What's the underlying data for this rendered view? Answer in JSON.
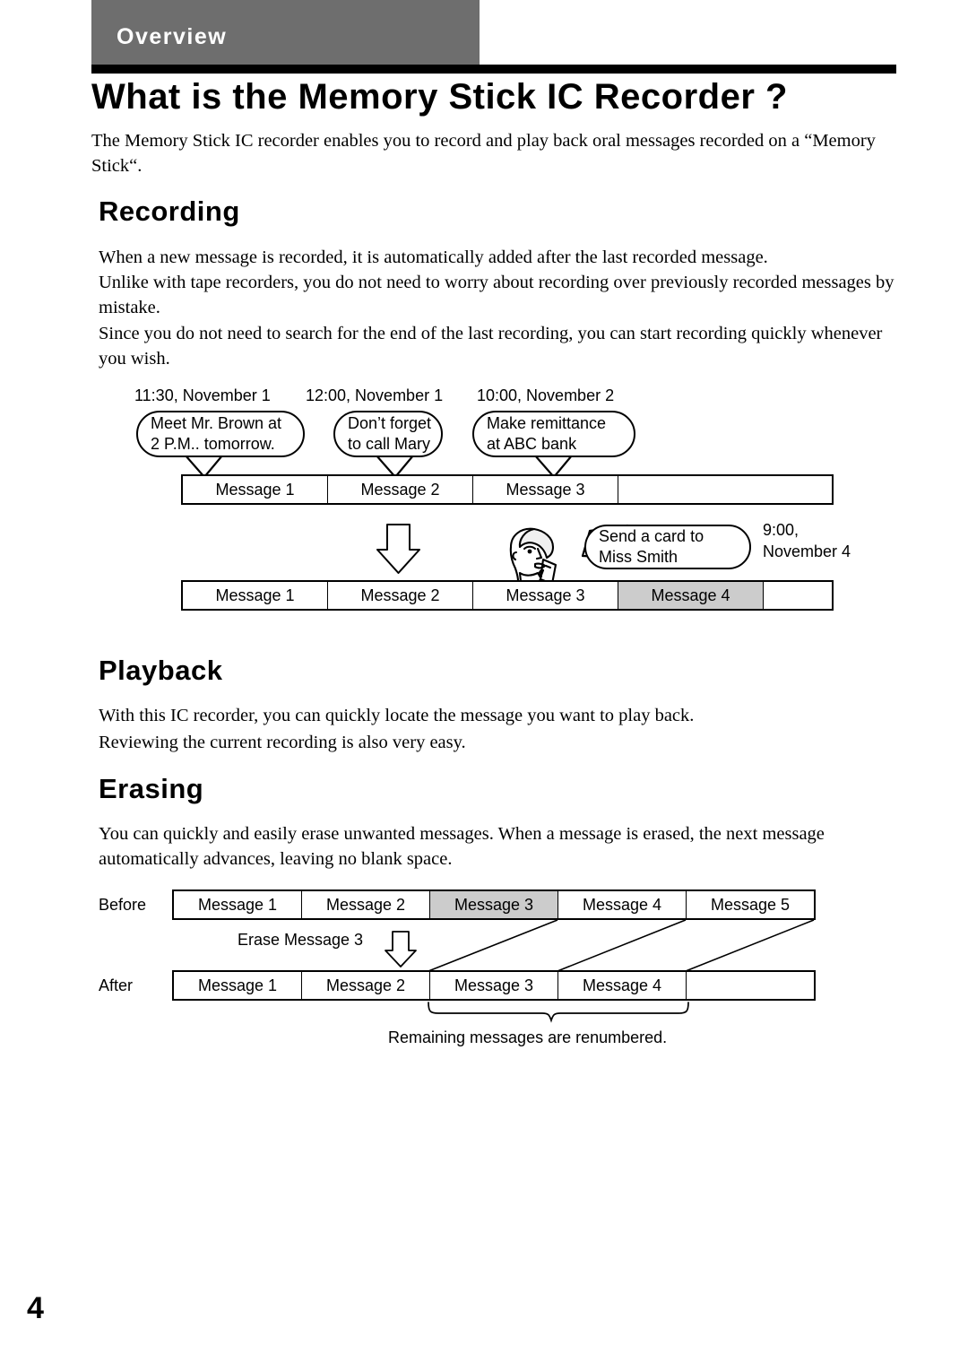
{
  "header": {
    "tab_label": "Overview",
    "title": "What is the Memory Stick IC Recorder ?"
  },
  "intro": "The Memory Stick IC recorder enables you to record and play back oral messages recorded on a “Memory Stick“.",
  "sections": {
    "recording": {
      "heading": "Recording",
      "paragraphs": [
        "When a new message is recorded, it is automatically added after the last recorded message.",
        "Unlike with tape recorders, you do not need to worry about recording over previously recorded messages by mistake.",
        "Since you do not need to search for the end of the last recording, you can start recording quickly whenever you wish."
      ]
    },
    "playback": {
      "heading": "Playback",
      "paragraphs": [
        "With this IC recorder, you can quickly locate the message you want to play back.",
        "Reviewing the current recording is also very easy."
      ]
    },
    "erasing": {
      "heading": "Erasing",
      "paragraphs": [
        "You can quickly and easily erase unwanted messages. When a message is erased, the next message automatically advances,  leaving no blank space."
      ]
    }
  },
  "recording_diagram": {
    "timestamps": [
      "11:30,  November 1",
      "12:00,  November 1",
      "10:00,  November 2"
    ],
    "bubbles": [
      {
        "line1": "Meet Mr. Brown at",
        "line2": "2 P.M.. tomorrow."
      },
      {
        "line1": "Don’t forget",
        "line2": "to call Mary"
      },
      {
        "line1": "Make remittance",
        "line2": "at ABC bank"
      }
    ],
    "row_before": [
      {
        "label": "Message 1",
        "shaded": false
      },
      {
        "label": "Message 2",
        "shaded": false
      },
      {
        "label": "Message 3",
        "shaded": false
      },
      {
        "label": "",
        "shaded": false
      }
    ],
    "new_bubble": {
      "line1": "Send a card to",
      "line2": "Miss Smith"
    },
    "new_stamp_line1": "9:00,",
    "new_stamp_line2": "November 4",
    "row_after": [
      {
        "label": "Message 1",
        "shaded": false
      },
      {
        "label": "Message 2",
        "shaded": false
      },
      {
        "label": "Message 3",
        "shaded": false
      },
      {
        "label": "Message 4",
        "shaded": true
      },
      {
        "label": "",
        "shaded": false
      }
    ],
    "arrow_icon": "down-arrow-icon",
    "person_icon": "person-speaking-icon"
  },
  "erasing_diagram": {
    "before_label": "Before",
    "after_label": "After",
    "erase_action_label": "Erase Message 3",
    "arrow_icon": "down-arrow-icon",
    "before_row": [
      {
        "label": "Message 1",
        "shaded": false
      },
      {
        "label": "Message 2",
        "shaded": false
      },
      {
        "label": "Message 3",
        "shaded": true
      },
      {
        "label": "Message 4",
        "shaded": false
      },
      {
        "label": "Message 5",
        "shaded": false
      },
      {
        "label": "",
        "shaded": false
      }
    ],
    "after_row": [
      {
        "label": "Message 1",
        "shaded": false
      },
      {
        "label": "Message 2",
        "shaded": false
      },
      {
        "label": "Message 3",
        "shaded": false
      },
      {
        "label": "Message 4",
        "shaded": false
      },
      {
        "label": "",
        "shaded": false
      }
    ],
    "caption": "Remaining messages are renumbered."
  },
  "footer": {
    "page_number": "4"
  },
  "colors": {
    "tab_gray": "#6e6e6e",
    "rule_black": "#000000",
    "cell_shade": "#cccccc"
  }
}
